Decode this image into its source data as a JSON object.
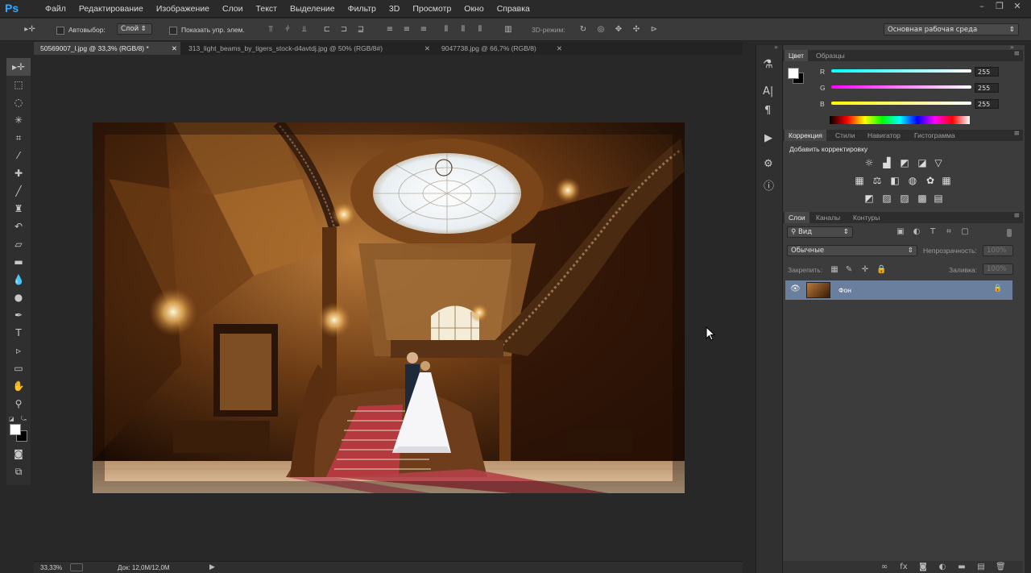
{
  "app": {
    "logo": "Ps"
  },
  "menu": [
    "Файл",
    "Редактирование",
    "Изображение",
    "Слои",
    "Текст",
    "Выделение",
    "Фильтр",
    "3D",
    "Просмотр",
    "Окно",
    "Справка"
  ],
  "window_controls": {
    "minimize": "–",
    "restore": "❐",
    "close": "✕"
  },
  "options": {
    "autoselect_label": "Автовыбор:",
    "autoselect_value": "Слой",
    "show_transform_label": "Показать упр. элем.",
    "mode_3d_label": "3D-режим:",
    "workspace": "Основная рабочая среда"
  },
  "doc_tabs": [
    {
      "title": "50569007_l.jpg @ 33,3% (RGB/8) *",
      "active": true
    },
    {
      "title": "313_light_beams_by_tigers_stock-d4avtdj.jpg @ 50% (RGB/8#)",
      "active": false
    },
    {
      "title": "9047738.jpg @ 66,7% (RGB/8)",
      "active": false
    }
  ],
  "status": {
    "zoom": "33,33%",
    "doc": "Док: 12,0M/12,0M"
  },
  "color_panel": {
    "tabs": [
      "Цвет",
      "Образцы"
    ],
    "channels": [
      {
        "label": "R",
        "value": "255"
      },
      {
        "label": "G",
        "value": "255"
      },
      {
        "label": "B",
        "value": "255"
      }
    ]
  },
  "adjust_panel": {
    "tabs": [
      "Коррекция",
      "Стили",
      "Навигатор",
      "Гистограмма"
    ],
    "title": "Добавить корректировку"
  },
  "layers_panel": {
    "tabs": [
      "Слои",
      "Каналы",
      "Контуры"
    ],
    "filter_label": "Вид",
    "blend_mode": "Обычные",
    "opacity_label": "Непрозрачность:",
    "opacity_value": "100%",
    "lock_label": "Закрепить:",
    "fill_label": "Заливка:",
    "fill_value": "100%",
    "layers": [
      {
        "name": "Фон",
        "visible": true,
        "locked": true
      }
    ]
  },
  "colors": {
    "accent": "#31a8ff",
    "selected_layer": "#6a7e9d",
    "bg": "#282828"
  }
}
